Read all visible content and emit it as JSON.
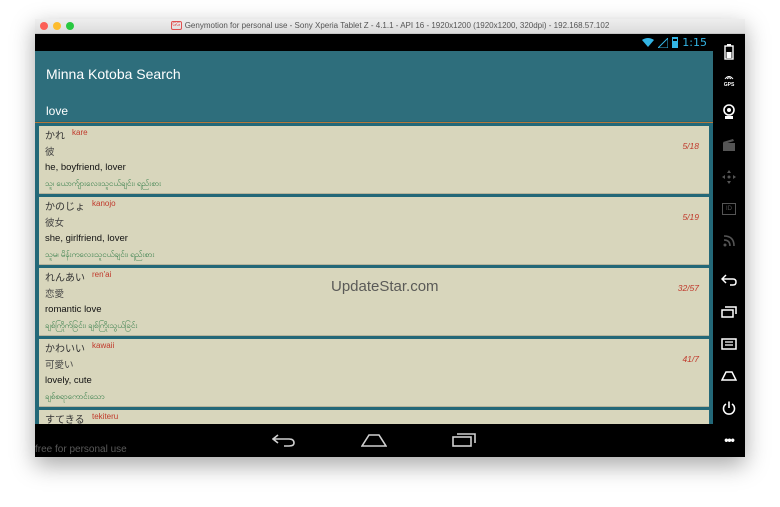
{
  "window": {
    "title": "Genymotion for personal use - Sony Xperia Tablet Z - 4.1.1 - API 16 - 1920x1200 (1920x1200, 320dpi) - 192.168.57.102",
    "logo_text": "GG"
  },
  "status_bar": {
    "time": "1:15"
  },
  "app": {
    "title": "Minna Kotoba Search",
    "search": {
      "value": "love",
      "placeholder": ""
    }
  },
  "results": [
    {
      "kana": "かれ",
      "romaji": "kare",
      "kanji": "彼",
      "english": "he, boyfriend, lover",
      "burmese": "သူ၊ ယောက်ျားလေး၊သူငယ်ချင်း၊ ရည်းစား",
      "lesson": "5/18"
    },
    {
      "kana": "かのじょ",
      "romaji": "kanojo",
      "kanji": "彼女",
      "english": "she, girlfriend, lover",
      "burmese": "သူမ၊ မိန်းကလေး၊သူငယ်ချင်း၊ ရည်းစား",
      "lesson": "5/19"
    },
    {
      "kana": "れんあい",
      "romaji": "ren'ai",
      "kanji": "恋愛",
      "english": "romantic love",
      "burmese": "ချစ်ကြိုက်ခြင်း၊ ချစ်ကြိုးသွယ်ခြင်း",
      "lesson": "32/57"
    },
    {
      "kana": "かわいい",
      "romaji": "kawaii",
      "kanji": "可愛い",
      "english": "lovely, cute",
      "burmese": "ချစ်စရာကောင်းသော",
      "lesson": "41/7"
    },
    {
      "kana": "すてきる",
      "romaji": "tekiteru",
      "kanji": "",
      "english": "",
      "burmese": "",
      "lesson": ""
    }
  ],
  "watermarks": {
    "center": "UpdateStar.com",
    "bottom": "free for personal use"
  },
  "toolbar": {
    "gps_label": "GPS",
    "id_label": "ID"
  },
  "colors": {
    "action_bar": "#2e6e7c",
    "card_bg": "#d8d6bc",
    "romaji": "#c0392b",
    "burmese": "#2e7a45",
    "status_accent": "#33b5e5"
  }
}
